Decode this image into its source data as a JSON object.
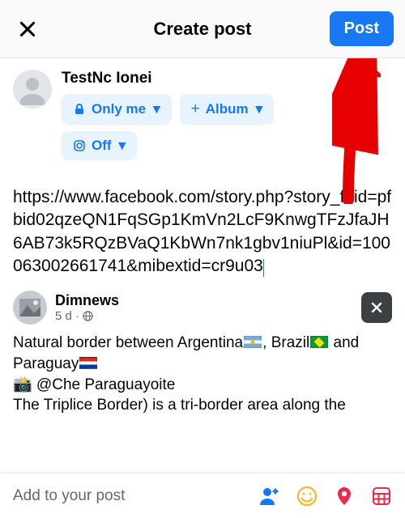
{
  "header": {
    "title": "Create post",
    "post_button": "Post"
  },
  "author": {
    "name": "TestNc Ionei",
    "privacy_label": "Only me",
    "album_label": "Album",
    "instagram_label": "Off"
  },
  "post_text": "https://www.facebook.com/story.php?story_fbid=pfbid02qzeQN1FqSGp1KmVn2LcF9KnwgTFzJfaJH6AB73k5RQzBVaQ1KbWn7nk1gbv1niuPl&id=100063002661741&mibextid=cr9u03",
  "attachment": {
    "page_name": "Dimnews",
    "age": "5 d",
    "body_pre": "Natural border between Argentina",
    "body_mid1": ", Brazil",
    "body_mid2": " and Paraguay",
    "body_line2_pre": "📸 @Che Paraguayoite",
    "body_line3": "The Triplice Border) is a tri-border area along the"
  },
  "footer": {
    "label": "Add to your post"
  },
  "icons": {
    "plus": "+",
    "caret": "▾",
    "dot": "·",
    "globe": "🌐"
  }
}
